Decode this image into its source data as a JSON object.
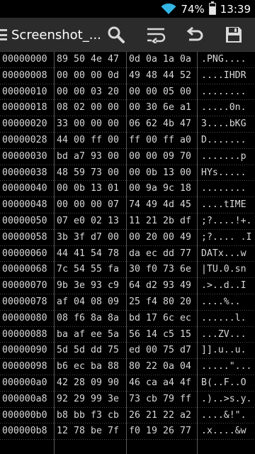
{
  "status": {
    "battery": "74%",
    "time": "13:39",
    "battery_level": 0.74
  },
  "toolbar": {
    "title": "Screenshot_...",
    "icons": [
      "menu-icon",
      "search-icon",
      "wrap-icon",
      "undo-icon",
      "save-icon"
    ]
  },
  "hex_rows": [
    {
      "offset": "00000000",
      "bytes": [
        "89",
        "50",
        "4e",
        "47",
        "0d",
        "0a",
        "1a",
        "0a"
      ],
      "ascii": ".PNG...."
    },
    {
      "offset": "00000008",
      "bytes": [
        "00",
        "00",
        "00",
        "0d",
        "49",
        "48",
        "44",
        "52"
      ],
      "ascii": "....IHDR"
    },
    {
      "offset": "00000010",
      "bytes": [
        "00",
        "00",
        "03",
        "20",
        "00",
        "00",
        "05",
        "00"
      ],
      "ascii": "........"
    },
    {
      "offset": "00000018",
      "bytes": [
        "08",
        "02",
        "00",
        "00",
        "00",
        "30",
        "6e",
        "a1"
      ],
      "ascii": ".....0n."
    },
    {
      "offset": "00000020",
      "bytes": [
        "33",
        "00",
        "00",
        "00",
        "06",
        "62",
        "4b",
        "47"
      ],
      "ascii": "3....bKG"
    },
    {
      "offset": "00000028",
      "bytes": [
        "44",
        "00",
        "ff",
        "00",
        "ff",
        "00",
        "ff",
        "a0"
      ],
      "ascii": "D......."
    },
    {
      "offset": "00000030",
      "bytes": [
        "bd",
        "a7",
        "93",
        "00",
        "00",
        "00",
        "09",
        "70"
      ],
      "ascii": ".......p"
    },
    {
      "offset": "00000038",
      "bytes": [
        "48",
        "59",
        "73",
        "00",
        "00",
        "0b",
        "13",
        "00"
      ],
      "ascii": "HYs....."
    },
    {
      "offset": "00000040",
      "bytes": [
        "00",
        "0b",
        "13",
        "01",
        "00",
        "9a",
        "9c",
        "18"
      ],
      "ascii": "........"
    },
    {
      "offset": "00000048",
      "bytes": [
        "00",
        "00",
        "00",
        "07",
        "74",
        "49",
        "4d",
        "45"
      ],
      "ascii": "....tIME"
    },
    {
      "offset": "00000050",
      "bytes": [
        "07",
        "e0",
        "02",
        "13",
        "11",
        "21",
        "2b",
        "df"
      ],
      "ascii": ";?....!+."
    },
    {
      "offset": "00000058",
      "bytes": [
        "3b",
        "3f",
        "d7",
        "00",
        "00",
        "20",
        "00",
        "49"
      ],
      "ascii": ";?.... .I"
    },
    {
      "offset": "00000060",
      "bytes": [
        "44",
        "41",
        "54",
        "78",
        "da",
        "ec",
        "dd",
        "77"
      ],
      "ascii": "DATx...w"
    },
    {
      "offset": "00000068",
      "bytes": [
        "7c",
        "54",
        "55",
        "fa",
        "30",
        "f0",
        "73",
        "6e"
      ],
      "ascii": "|TU.0.sn"
    },
    {
      "offset": "00000070",
      "bytes": [
        "9b",
        "3e",
        "93",
        "c9",
        "64",
        "d2",
        "93",
        "49"
      ],
      "ascii": ".>..d..I"
    },
    {
      "offset": "00000078",
      "bytes": [
        "af",
        "04",
        "08",
        "09",
        "25",
        "f4",
        "80",
        "20"
      ],
      "ascii": "....%.. "
    },
    {
      "offset": "00000080",
      "bytes": [
        "08",
        "f6",
        "8a",
        "8a",
        "bd",
        "17",
        "6c",
        "ec"
      ],
      "ascii": "......l."
    },
    {
      "offset": "00000088",
      "bytes": [
        "ba",
        "af",
        "ee",
        "5a",
        "56",
        "14",
        "c5",
        "15"
      ],
      "ascii": "...ZV..."
    },
    {
      "offset": "00000090",
      "bytes": [
        "5d",
        "5d",
        "dd",
        "75",
        "ed",
        "00",
        "75",
        "d7"
      ],
      "ascii": "]].u..u."
    },
    {
      "offset": "00000098",
      "bytes": [
        "b6",
        "ec",
        "ba",
        "88",
        "80",
        "22",
        "0a",
        "04"
      ],
      "ascii": ".....\"..."
    },
    {
      "offset": "000000a0",
      "bytes": [
        "42",
        "28",
        "09",
        "90",
        "46",
        "ca",
        "a4",
        "4f"
      ],
      "ascii": "B(..F..O"
    },
    {
      "offset": "000000a8",
      "bytes": [
        "92",
        "29",
        "99",
        "3e",
        "73",
        "cb",
        "79",
        "ff"
      ],
      "ascii": ".)..>s.y."
    },
    {
      "offset": "000000b0",
      "bytes": [
        "b8",
        "bb",
        "f3",
        "cb",
        "26",
        "21",
        "22",
        "a2"
      ],
      "ascii": "....&!\"."
    },
    {
      "offset": "000000b8",
      "bytes": [
        "12",
        "78",
        "be",
        "7f",
        "f0",
        "19",
        "26",
        "77"
      ],
      "ascii": ".x....&w"
    }
  ],
  "colors": {
    "background": "#000000",
    "text": "#d8d8d8",
    "actionbar": "#2b2b2b",
    "wifi": "#33b5e5"
  }
}
